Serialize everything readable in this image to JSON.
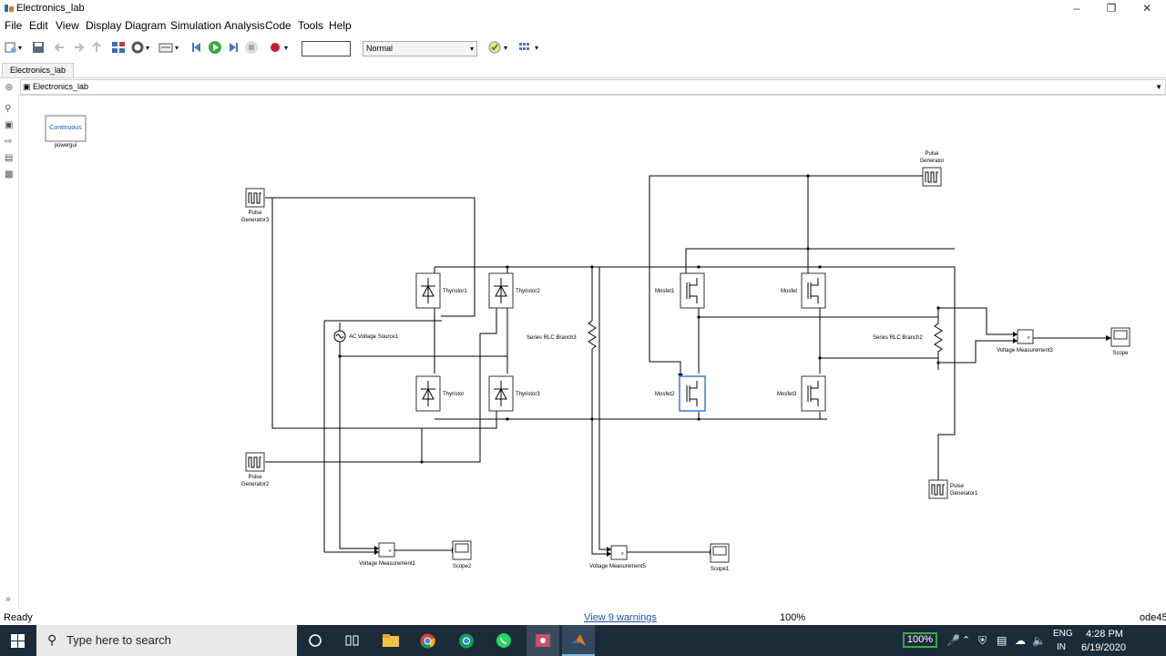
{
  "window": {
    "title": "Electronics_lab"
  },
  "menu": [
    "File",
    "Edit",
    "View",
    "Display",
    "Diagram",
    "Simulation",
    "Analysis",
    "Code",
    "Tools",
    "Help"
  ],
  "toolbar": {
    "stop_time": "",
    "sim_mode": "Normal"
  },
  "tab": {
    "label": "Electronics_lab"
  },
  "address": {
    "path": "Electronics_lab"
  },
  "powergui": {
    "inner": "Continuous",
    "label": "powergui"
  },
  "blocks": {
    "pg3_a": "Pulse",
    "pg3_b": "Generator3",
    "pg2_a": "Pulse",
    "pg2_b": "Generator2",
    "pg_a": "Pulse",
    "pg_b": "Generator",
    "pg1_a": "Pulse",
    "pg1_b": "Generator1",
    "thyristor1": "Thyristor1",
    "thyristor2": "Thyristor2",
    "thyristor": "Thyristor",
    "thyristor3": "Thyristor3",
    "ac": "AC Voltage Source1",
    "rlc3": "Series RLC Branch3",
    "rlc2": "Series RLC Branch2",
    "mosfet1": "Mosfet1",
    "mosfet": "Mosfet",
    "mosfet2": "Mosfet2",
    "mosfet3": "Mosfet3",
    "vm1": "Voltage Measurement1",
    "vm5": "Voltage Measurement5",
    "vm3": "Voltage Measurement3",
    "scope2": "Scope2",
    "scope1": "Scope1",
    "scope": "Scope"
  },
  "status": {
    "left": "Ready",
    "warnings": "View 9 warnings",
    "zoom": "100%",
    "solver": "ode45"
  },
  "taskbar": {
    "search_placeholder": "Type here to search",
    "battery": "100%",
    "lang1": "ENG",
    "lang2": "IN",
    "time": "4:28 PM",
    "date": "6/19/2020"
  }
}
